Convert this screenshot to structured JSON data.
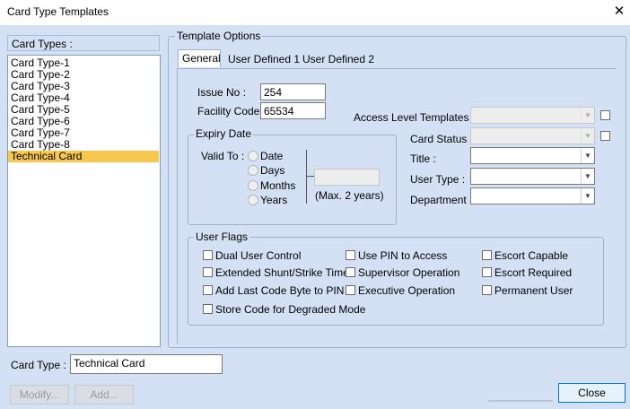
{
  "window": {
    "title": "Card Type Templates",
    "close_glyph": "✕"
  },
  "card_types": {
    "header": "Card Types :",
    "items": [
      "Card Type-1",
      "Card Type-2",
      "Card Type-3",
      "Card Type-4",
      "Card Type-5",
      "Card Type-6",
      "Card Type-7",
      "Card Type-8",
      "Technical Card"
    ],
    "selected": "Technical Card"
  },
  "template_options": {
    "legend": "Template Options",
    "tabs": [
      "General",
      "User Defined 1",
      "User Defined 2"
    ],
    "active_tab": "General"
  },
  "general": {
    "issue_no_label": "Issue No :",
    "issue_no_value": "254",
    "facility_code_label": "Facility Code :",
    "facility_code_value": "65534",
    "access_level_label": "Access Level Templates :",
    "card_status_label": "Card Status :",
    "title_label": "Title :",
    "user_type_label": "User Type :",
    "department_label": "Department :"
  },
  "expiry": {
    "legend": "Expiry Date",
    "valid_to_label": "Valid To :",
    "options": [
      "Date",
      "Days",
      "Months",
      "Years"
    ],
    "max_note": "(Max. 2 years)"
  },
  "user_flags": {
    "legend": "User Flags",
    "col1": [
      "Dual User Control",
      "Extended Shunt/Strike Time",
      "Add Last Code Byte to PIN",
      "Store Code for Degraded Mode"
    ],
    "col2": [
      "Use PIN to Access",
      "Supervisor Operation",
      "Executive Operation"
    ],
    "col3": [
      "Escort Capable",
      "Escort Required",
      "Permanent User"
    ]
  },
  "footer": {
    "card_type_label": "Card Type :",
    "card_type_value": "Technical Card",
    "modify_label": "Modify...",
    "add_label": "Add...",
    "close_label": "Close"
  },
  "icons": {
    "dropdown": "▼"
  },
  "colors": {
    "background": "#d4e1f5",
    "selection": "#f7c74f",
    "border": "#9db1d0"
  }
}
